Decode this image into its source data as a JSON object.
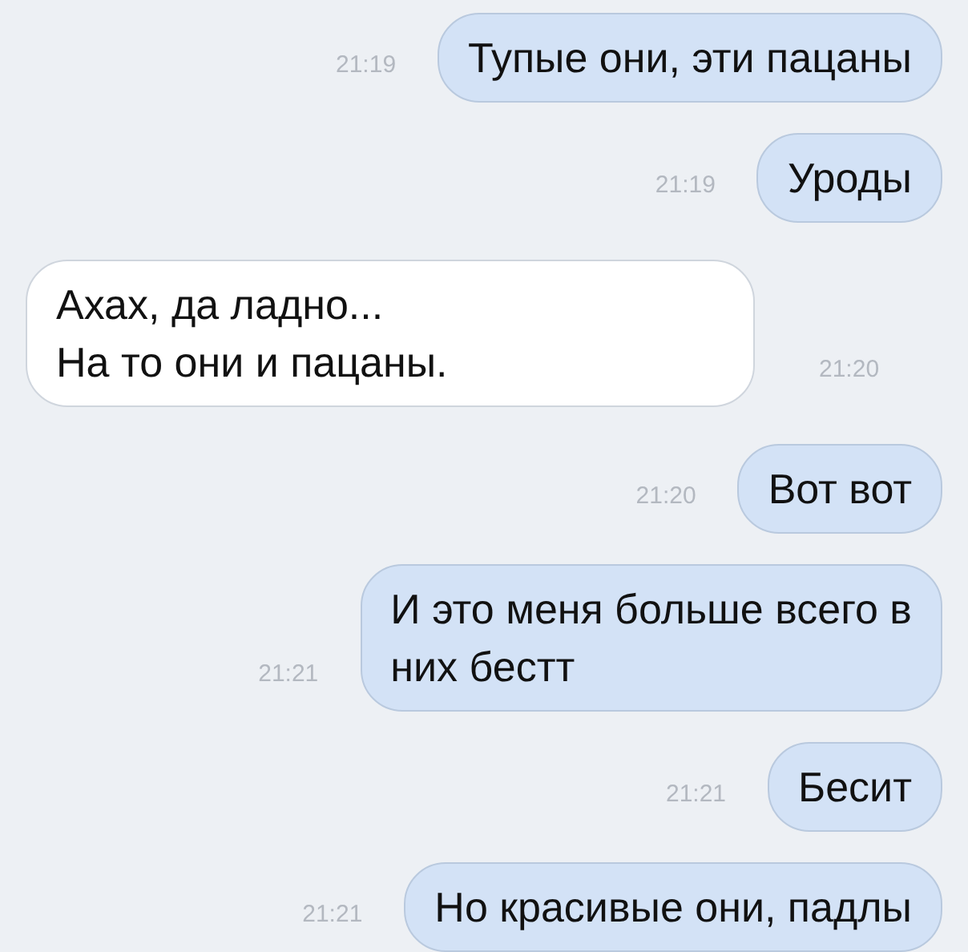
{
  "messages": [
    {
      "kind": "outgoing",
      "text": [
        "Тупые они, эти пацаны"
      ],
      "time": "21:19"
    },
    {
      "kind": "outgoing",
      "text": [
        "Уроды"
      ],
      "time": "21:19"
    },
    {
      "kind": "incoming",
      "text": [
        "Ахах, да ладно...",
        "На то они и пацаны."
      ],
      "time": "21:20"
    },
    {
      "kind": "outgoing",
      "text": [
        "Вот вот"
      ],
      "time": "21:20"
    },
    {
      "kind": "outgoing",
      "text": [
        "И это меня больше всего в",
        "них бестт"
      ],
      "time": "21:21"
    },
    {
      "kind": "outgoing",
      "text": [
        "Бесит"
      ],
      "time": "21:21"
    },
    {
      "kind": "outgoing",
      "text": [
        "Но красивые они, падлы"
      ],
      "time": "21:21"
    }
  ]
}
